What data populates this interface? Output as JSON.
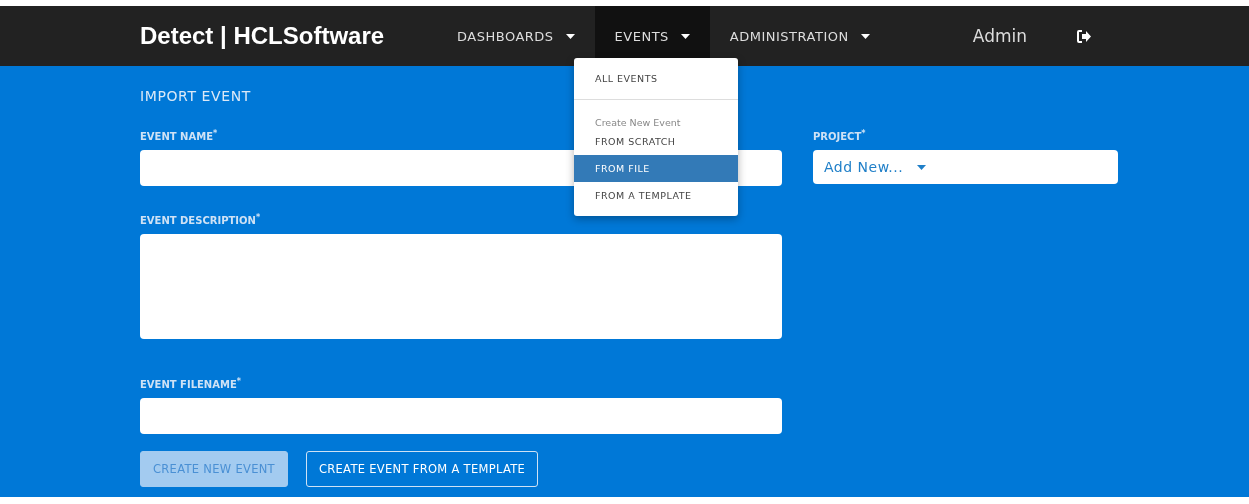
{
  "brand": "Detect | HCLSoftware",
  "nav": [
    {
      "label": "DASHBOARDS",
      "selected": false
    },
    {
      "label": "EVENTS",
      "selected": true
    },
    {
      "label": "ADMINISTRATION",
      "selected": false
    }
  ],
  "user": "Admin",
  "menu": {
    "items": [
      {
        "kind": "link",
        "label": "ALL EVENTS",
        "selected": false
      },
      {
        "kind": "divider"
      },
      {
        "kind": "header",
        "label": "Create New Event"
      },
      {
        "kind": "link",
        "label": "FROM SCRATCH",
        "selected": false
      },
      {
        "kind": "link",
        "label": "FROM FILE",
        "selected": true
      },
      {
        "kind": "link",
        "label": "FROM A TEMPLATE",
        "selected": false
      }
    ]
  },
  "page_title": "IMPORT EVENT",
  "fields": {
    "event_name": {
      "label": "EVENT NAME$^{*}$"
    },
    "project": {
      "label": "PROJECT$^{*}$",
      "value": "Add New..."
    },
    "event_description": {
      "label": "EVENT DESCRIPTION$^{*}$"
    },
    "event_filename": {
      "label": "EVENT FILENAME$^{*}$"
    }
  },
  "buttons": [
    {
      "label": "CREATE NEW EVENT",
      "disabled": true
    },
    {
      "label": "CREATE EVENT FROM A TEMPLATE",
      "disabled": false
    }
  ]
}
